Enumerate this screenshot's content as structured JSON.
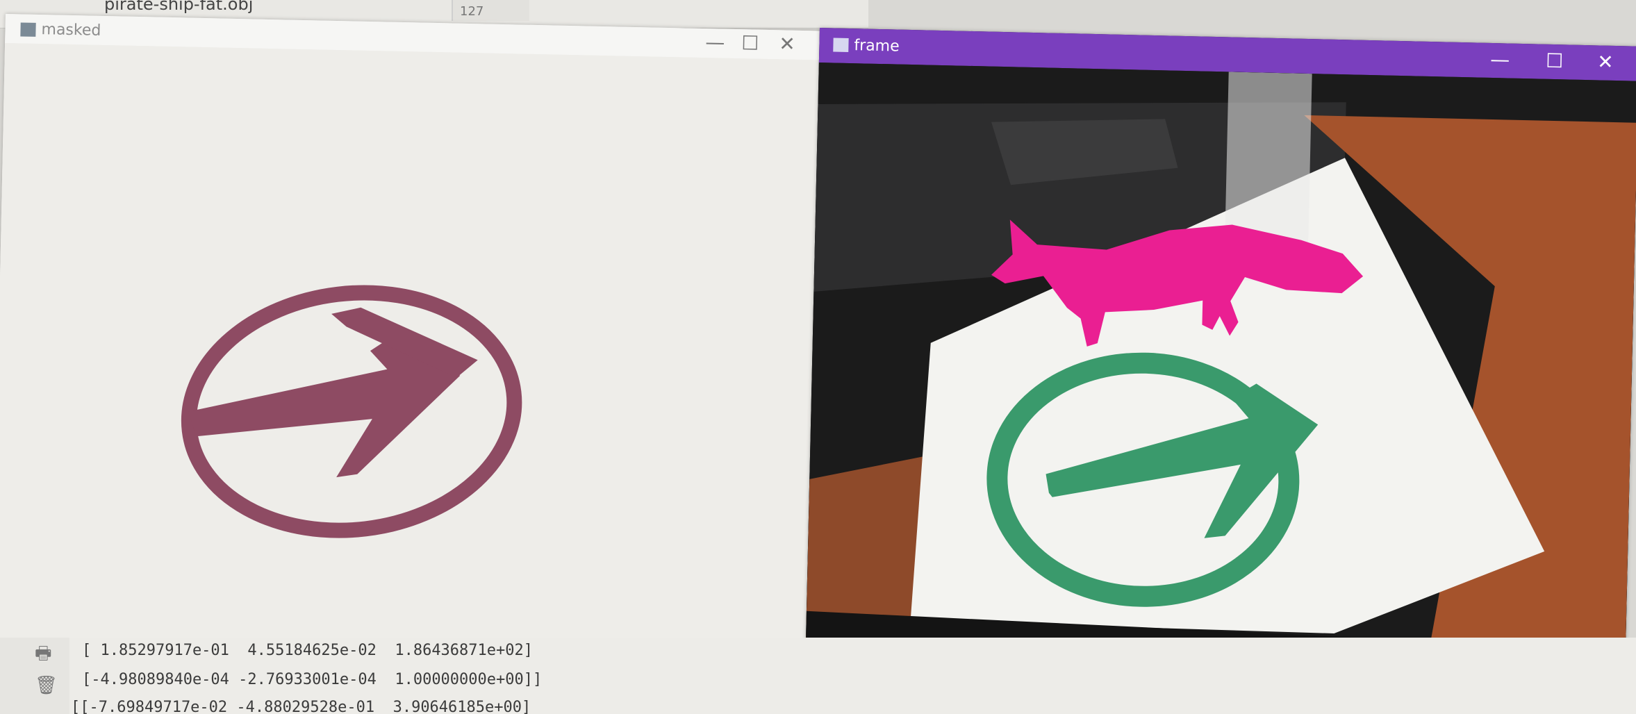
{
  "ide": {
    "filename": "pirate-ship-fat.obj",
    "side_number": "127"
  },
  "windows": {
    "masked": {
      "title": "masked",
      "controls": {
        "minimize": "—",
        "maximize": "☐",
        "close": "✕"
      }
    },
    "frame": {
      "title": "frame",
      "controls": {
        "minimize": "—",
        "maximize": "☐",
        "close": "✕"
      }
    }
  },
  "console": {
    "lines": [
      "[ 1.85297917e-01  4.55184625e-02  1.86436871e+02]",
      "[-4.98089840e-04 -2.76933001e-04  1.00000000e+00]]",
      "[[-7.69849717e-02 -4.88029528e-01  3.90646185e+00]"
    ]
  },
  "colors": {
    "frame_titlebar": "#7a3fbe",
    "marker_masked": "#8e4b63",
    "marker_frame": "#3a9a6c",
    "fox": "#ea1f92"
  }
}
